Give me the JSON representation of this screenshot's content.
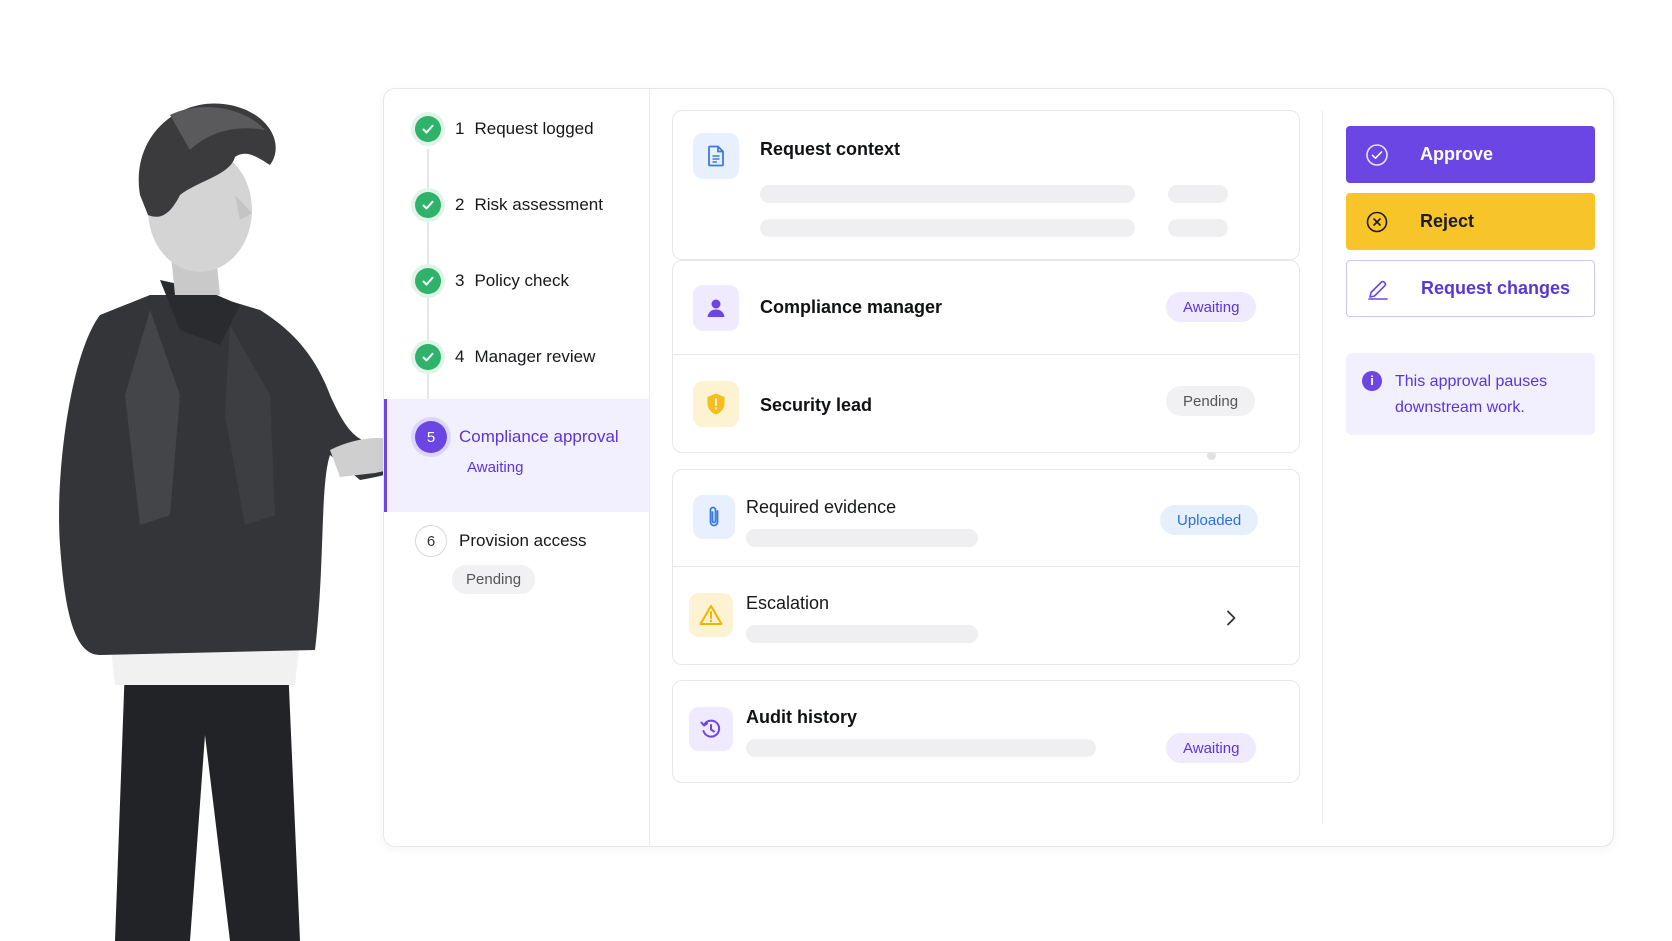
{
  "steps": [
    {
      "n": "1",
      "label": "Request logged",
      "state": "done"
    },
    {
      "n": "2",
      "label": "Risk assessment",
      "state": "done"
    },
    {
      "n": "3",
      "label": "Policy check",
      "state": "done"
    },
    {
      "n": "4",
      "label": "Manager review",
      "state": "done"
    },
    {
      "n": "5",
      "label": "Compliance approval",
      "state": "active",
      "status": "Awaiting"
    },
    {
      "n": "6",
      "label": "Provision access",
      "state": "pending",
      "status": "Pending"
    }
  ],
  "panels": {
    "request_context": {
      "title": "Request context"
    },
    "compliance_manager": {
      "title": "Compliance manager",
      "status": "Awaiting"
    },
    "security_lead": {
      "title": "Security lead",
      "status": "Pending"
    },
    "required_evidence": {
      "title": "Required evidence",
      "status": "Uploaded"
    },
    "escalation": {
      "title": "Escalation"
    },
    "audit_history": {
      "title": "Audit history",
      "status": "Awaiting"
    }
  },
  "actions": {
    "approve": "Approve",
    "reject": "Reject",
    "request_changes": "Request changes"
  },
  "info": {
    "text": "This approval pauses downstream work."
  },
  "colors": {
    "accent": "#6b46e5",
    "success": "#2fb36a",
    "warning": "#f7c52a",
    "info_blue": "#2c6fdc"
  },
  "icons": {
    "step_done": "check-icon",
    "request_context": "document-icon",
    "compliance_manager": "user-icon",
    "security_lead": "shield-icon",
    "required_evidence": "paperclip-icon",
    "escalation": "warning-icon",
    "audit_history": "history-icon",
    "approve": "check-circle-icon",
    "reject": "x-circle-icon",
    "request_changes": "pencil-icon",
    "info": "info-icon"
  }
}
